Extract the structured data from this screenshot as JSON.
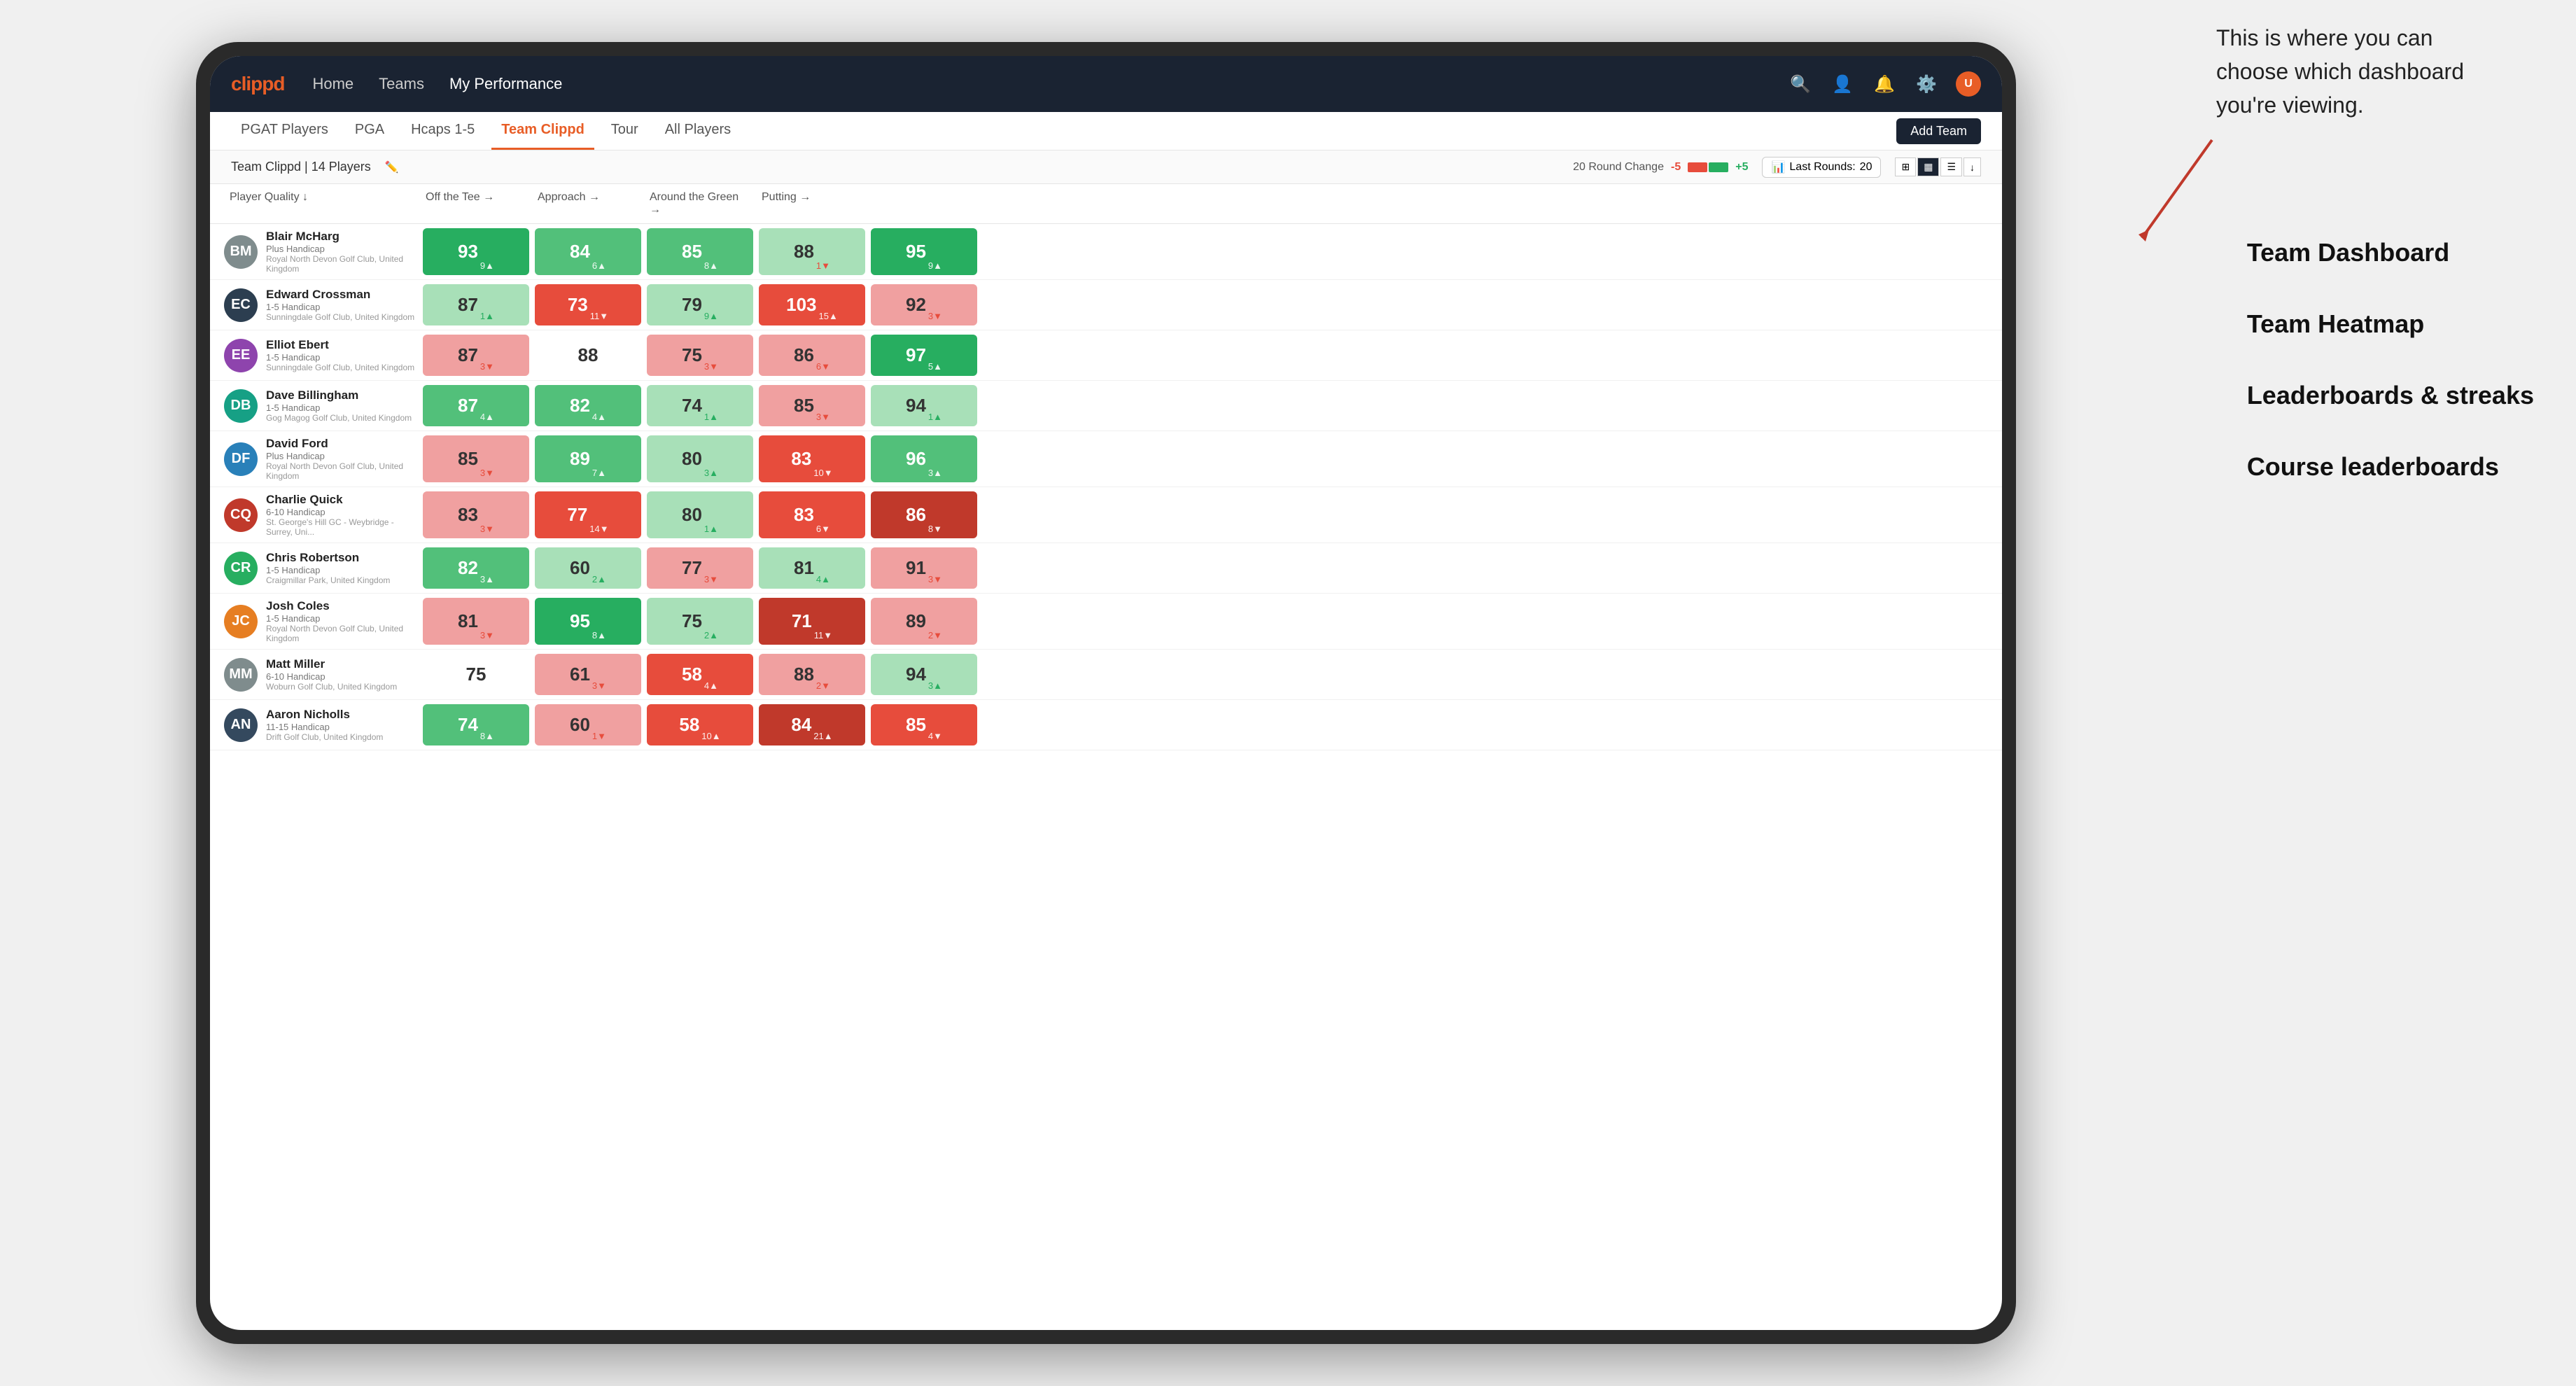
{
  "annotation": {
    "text_line1": "This is where you can",
    "text_line2": "choose which dashboard",
    "text_line3": "you're viewing."
  },
  "side_labels": [
    "Team Dashboard",
    "Team Heatmap",
    "Leaderboards & streaks",
    "Course leaderboards"
  ],
  "navbar": {
    "logo": "clippd",
    "items": [
      "Home",
      "Teams",
      "My Performance"
    ],
    "active": "My Performance"
  },
  "subnav": {
    "tabs": [
      "PGAT Players",
      "PGA",
      "Hcaps 1-5",
      "Team Clippd",
      "Tour",
      "All Players"
    ],
    "active": "Team Clippd",
    "add_button": "Add Team"
  },
  "teambar": {
    "team_name": "Team Clippd",
    "player_count": "14 Players",
    "round_change_label": "20 Round Change",
    "round_change_neg": "-5",
    "round_change_pos": "+5",
    "last_rounds_label": "Last Rounds:",
    "last_rounds_value": "20"
  },
  "table": {
    "columns": [
      "Player Quality ↓",
      "Off the Tee →",
      "Approach →",
      "Around the Green →",
      "Putting →"
    ],
    "players": [
      {
        "name": "Blair McHarg",
        "handicap": "Plus Handicap",
        "club": "Royal North Devon Golf Club, United Kingdom",
        "initials": "BM",
        "av_class": "av1",
        "stats": [
          {
            "value": "93",
            "change": "9▲",
            "bg": "bg-green-strong",
            "change_class": "change-up-white"
          },
          {
            "value": "84",
            "change": "6▲",
            "bg": "bg-green-mid",
            "change_class": "change-up-white"
          },
          {
            "value": "85",
            "change": "8▲",
            "bg": "bg-green-mid",
            "change_class": "change-up-white"
          },
          {
            "value": "88",
            "change": "1▼",
            "bg": "bg-green-light",
            "change_class": "change-down"
          },
          {
            "value": "95",
            "change": "9▲",
            "bg": "bg-green-strong",
            "change_class": "change-up-white"
          }
        ]
      },
      {
        "name": "Edward Crossman",
        "handicap": "1-5 Handicap",
        "club": "Sunningdale Golf Club, United Kingdom",
        "initials": "EC",
        "av_class": "av2",
        "stats": [
          {
            "value": "87",
            "change": "1▲",
            "bg": "bg-green-light",
            "change_class": "change-up"
          },
          {
            "value": "73",
            "change": "11▼",
            "bg": "bg-red-mid",
            "change_class": "change-down-white"
          },
          {
            "value": "79",
            "change": "9▲",
            "bg": "bg-green-light",
            "change_class": "change-up"
          },
          {
            "value": "103",
            "change": "15▲",
            "bg": "bg-red-mid",
            "change_class": "change-up-white"
          },
          {
            "value": "92",
            "change": "3▼",
            "bg": "bg-red-light",
            "change_class": "change-down"
          }
        ]
      },
      {
        "name": "Elliot Ebert",
        "handicap": "1-5 Handicap",
        "club": "Sunningdale Golf Club, United Kingdom",
        "initials": "EE",
        "av_class": "av3",
        "stats": [
          {
            "value": "87",
            "change": "3▼",
            "bg": "bg-red-light",
            "change_class": "change-down"
          },
          {
            "value": "88",
            "change": "",
            "bg": "bg-white",
            "change_class": ""
          },
          {
            "value": "75",
            "change": "3▼",
            "bg": "bg-red-light",
            "change_class": "change-down"
          },
          {
            "value": "86",
            "change": "6▼",
            "bg": "bg-red-light",
            "change_class": "change-down"
          },
          {
            "value": "97",
            "change": "5▲",
            "bg": "bg-green-strong",
            "change_class": "change-up-white"
          }
        ]
      },
      {
        "name": "Dave Billingham",
        "handicap": "1-5 Handicap",
        "club": "Gog Magog Golf Club, United Kingdom",
        "initials": "DB",
        "av_class": "av4",
        "stats": [
          {
            "value": "87",
            "change": "4▲",
            "bg": "bg-green-mid",
            "change_class": "change-up-white"
          },
          {
            "value": "82",
            "change": "4▲",
            "bg": "bg-green-mid",
            "change_class": "change-up-white"
          },
          {
            "value": "74",
            "change": "1▲",
            "bg": "bg-green-light",
            "change_class": "change-up"
          },
          {
            "value": "85",
            "change": "3▼",
            "bg": "bg-red-light",
            "change_class": "change-down"
          },
          {
            "value": "94",
            "change": "1▲",
            "bg": "bg-green-light",
            "change_class": "change-up"
          }
        ]
      },
      {
        "name": "David Ford",
        "handicap": "Plus Handicap",
        "club": "Royal North Devon Golf Club, United Kingdom",
        "initials": "DF",
        "av_class": "av5",
        "stats": [
          {
            "value": "85",
            "change": "3▼",
            "bg": "bg-red-light",
            "change_class": "change-down"
          },
          {
            "value": "89",
            "change": "7▲",
            "bg": "bg-green-mid",
            "change_class": "change-up-white"
          },
          {
            "value": "80",
            "change": "3▲",
            "bg": "bg-green-light",
            "change_class": "change-up"
          },
          {
            "value": "83",
            "change": "10▼",
            "bg": "bg-red-mid",
            "change_class": "change-down-white"
          },
          {
            "value": "96",
            "change": "3▲",
            "bg": "bg-green-mid",
            "change_class": "change-up-white"
          }
        ]
      },
      {
        "name": "Charlie Quick",
        "handicap": "6-10 Handicap",
        "club": "St. George's Hill GC - Weybridge - Surrey, Uni...",
        "initials": "CQ",
        "av_class": "av6",
        "stats": [
          {
            "value": "83",
            "change": "3▼",
            "bg": "bg-red-light",
            "change_class": "change-down"
          },
          {
            "value": "77",
            "change": "14▼",
            "bg": "bg-red-mid",
            "change_class": "change-down-white"
          },
          {
            "value": "80",
            "change": "1▲",
            "bg": "bg-green-light",
            "change_class": "change-up"
          },
          {
            "value": "83",
            "change": "6▼",
            "bg": "bg-red-mid",
            "change_class": "change-down-white"
          },
          {
            "value": "86",
            "change": "8▼",
            "bg": "bg-red-strong",
            "change_class": "change-down-white"
          }
        ]
      },
      {
        "name": "Chris Robertson",
        "handicap": "1-5 Handicap",
        "club": "Craigmillar Park, United Kingdom",
        "initials": "CR",
        "av_class": "av7",
        "stats": [
          {
            "value": "82",
            "change": "3▲",
            "bg": "bg-green-mid",
            "change_class": "change-up-white"
          },
          {
            "value": "60",
            "change": "2▲",
            "bg": "bg-green-light",
            "change_class": "change-up"
          },
          {
            "value": "77",
            "change": "3▼",
            "bg": "bg-red-light",
            "change_class": "change-down"
          },
          {
            "value": "81",
            "change": "4▲",
            "bg": "bg-green-light",
            "change_class": "change-up"
          },
          {
            "value": "91",
            "change": "3▼",
            "bg": "bg-red-light",
            "change_class": "change-down"
          }
        ]
      },
      {
        "name": "Josh Coles",
        "handicap": "1-5 Handicap",
        "club": "Royal North Devon Golf Club, United Kingdom",
        "initials": "JC",
        "av_class": "av8",
        "stats": [
          {
            "value": "81",
            "change": "3▼",
            "bg": "bg-red-light",
            "change_class": "change-down"
          },
          {
            "value": "95",
            "change": "8▲",
            "bg": "bg-green-strong",
            "change_class": "change-up-white"
          },
          {
            "value": "75",
            "change": "2▲",
            "bg": "bg-green-light",
            "change_class": "change-up"
          },
          {
            "value": "71",
            "change": "11▼",
            "bg": "bg-red-strong",
            "change_class": "change-down-white"
          },
          {
            "value": "89",
            "change": "2▼",
            "bg": "bg-red-light",
            "change_class": "change-down"
          }
        ]
      },
      {
        "name": "Matt Miller",
        "handicap": "6-10 Handicap",
        "club": "Woburn Golf Club, United Kingdom",
        "initials": "MM",
        "av_class": "av9",
        "stats": [
          {
            "value": "75",
            "change": "",
            "bg": "bg-white",
            "change_class": ""
          },
          {
            "value": "61",
            "change": "3▼",
            "bg": "bg-red-light",
            "change_class": "change-down"
          },
          {
            "value": "58",
            "change": "4▲",
            "bg": "bg-red-mid",
            "change_class": "change-up-white"
          },
          {
            "value": "88",
            "change": "2▼",
            "bg": "bg-red-light",
            "change_class": "change-down"
          },
          {
            "value": "94",
            "change": "3▲",
            "bg": "bg-green-light",
            "change_class": "change-up"
          }
        ]
      },
      {
        "name": "Aaron Nicholls",
        "handicap": "11-15 Handicap",
        "club": "Drift Golf Club, United Kingdom",
        "initials": "AN",
        "av_class": "av10",
        "stats": [
          {
            "value": "74",
            "change": "8▲",
            "bg": "bg-green-mid",
            "change_class": "change-up-white"
          },
          {
            "value": "60",
            "change": "1▼",
            "bg": "bg-red-light",
            "change_class": "change-down"
          },
          {
            "value": "58",
            "change": "10▲",
            "bg": "bg-red-mid",
            "change_class": "change-up-white"
          },
          {
            "value": "84",
            "change": "21▲",
            "bg": "bg-red-strong",
            "change_class": "change-up-white"
          },
          {
            "value": "85",
            "change": "4▼",
            "bg": "bg-red-mid",
            "change_class": "change-down-white"
          }
        ]
      }
    ]
  }
}
